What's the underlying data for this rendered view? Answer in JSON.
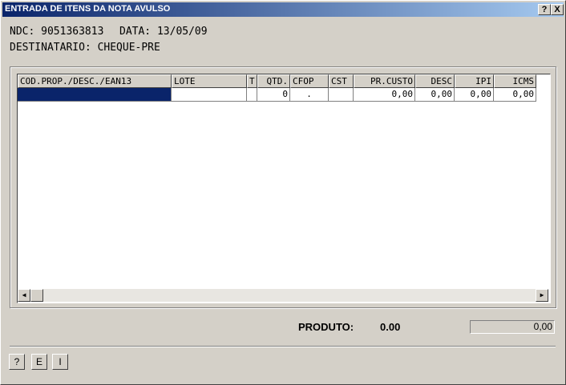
{
  "window": {
    "title": "ENTRADA DE ITENS DA NOTA AVULSO",
    "help_btn": "?",
    "close_btn": "X"
  },
  "header": {
    "ndc": "NDC: 9051363813",
    "data": "DATA: 13/05/09",
    "destinatario": "DESTINATARIO: CHEQUE-PRE"
  },
  "grid": {
    "columns": [
      "COD.PROP./DESC./EAN13",
      "LOTE",
      "T",
      "QTD.",
      "CFOP",
      "CST",
      "PR.CUSTO",
      "DESC",
      "IPI",
      "ICMS"
    ],
    "row": [
      "",
      "",
      "",
      "0",
      ".",
      "",
      "0,00",
      "0,00",
      "0,00",
      "0,00"
    ]
  },
  "scrollbar": {
    "left_arrow": "◀",
    "right_arrow": "▶"
  },
  "footer": {
    "produto_label": "PRODUTO:",
    "produto_value": "0.00",
    "total_value": "0,00"
  },
  "buttons": {
    "help": "?",
    "e": "E",
    "i": "I"
  }
}
